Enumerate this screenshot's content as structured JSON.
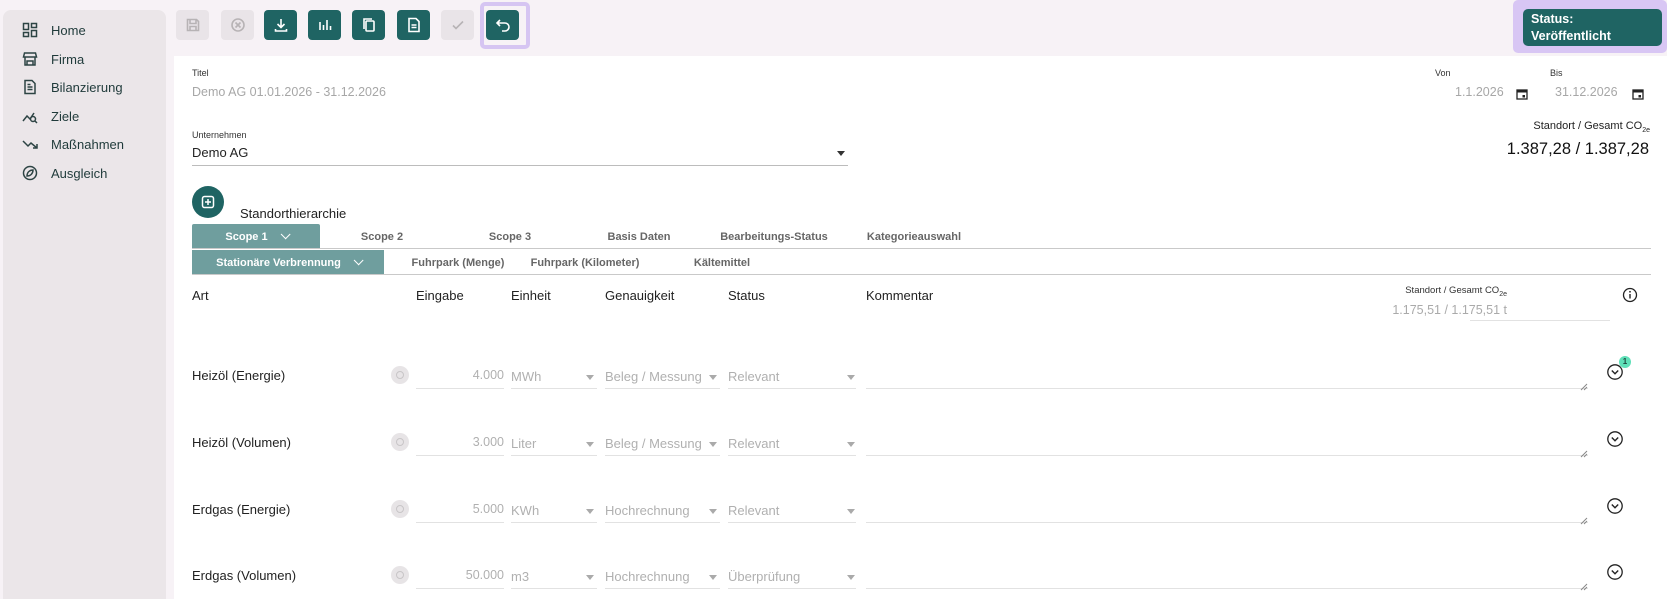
{
  "sidebar": {
    "items": [
      {
        "label": "Home",
        "icon": "dashboard-icon"
      },
      {
        "label": "Firma",
        "icon": "store-icon"
      },
      {
        "label": "Bilanzierung",
        "icon": "document-icon"
      },
      {
        "label": "Ziele",
        "icon": "target-chart-icon"
      },
      {
        "label": "Maßnahmen",
        "icon": "trend-down-icon"
      },
      {
        "label": "Ausgleich",
        "icon": "eco-icon"
      }
    ]
  },
  "toolbar": {
    "buttons": [
      {
        "name": "save-icon",
        "state": "disabled"
      },
      {
        "name": "cancel-icon",
        "state": "disabled"
      },
      {
        "name": "download-icon",
        "state": "active"
      },
      {
        "name": "chart-icon",
        "state": "active"
      },
      {
        "name": "copy-icon",
        "state": "active"
      },
      {
        "name": "file-icon",
        "state": "active"
      },
      {
        "name": "check-icon",
        "state": "disabled"
      },
      {
        "name": "undo-icon",
        "state": "active"
      }
    ]
  },
  "status": {
    "label_line1": "Status:",
    "label_line2": "Veröffentlicht"
  },
  "form": {
    "title_label": "Titel",
    "title_value": "Demo AG 01.01.2026 - 31.12.2026",
    "from_label": "Von",
    "from_value": "1.1.2026",
    "to_label": "Bis",
    "to_value": "31.12.2026",
    "company_label": "Unternehmen",
    "company_value": "Demo AG",
    "total_label": "Standort / Gesamt CO",
    "total_sub": "2e",
    "total_value": "1.387,28 / 1.387,28"
  },
  "hierarchy_title": "Standorthierarchie",
  "tabs": [
    "Scope 1",
    "Scope 2",
    "Scope 3",
    "Basis Daten",
    "Bearbeitungs-Status",
    "Kategorieauswahl"
  ],
  "subtabs": [
    "Stationäre Verbrennung",
    "Fuhrpark (Menge)",
    "Fuhrpark (Kilometer)",
    "Kältemittel"
  ],
  "columns": {
    "art": "Art",
    "eingabe": "Eingabe",
    "einheit": "Einheit",
    "genauigkeit": "Genauigkeit",
    "status": "Status",
    "kommentar": "Kommentar",
    "total_label": "Standort / Gesamt CO",
    "total_sub": "2e",
    "total_value": "1.175,51 / 1.175,51 t"
  },
  "rows": [
    {
      "art": "Heizöl (Energie)",
      "eingabe": "4.000",
      "einheit": "MWh",
      "genauigkeit": "Beleg / Messung",
      "status": "Relevant",
      "badge": "1"
    },
    {
      "art": "Heizöl (Volumen)",
      "eingabe": "3.000",
      "einheit": "Liter",
      "genauigkeit": "Beleg / Messung",
      "status": "Relevant"
    },
    {
      "art": "Erdgas (Energie)",
      "eingabe": "5.000",
      "einheit": "KWh",
      "genauigkeit": "Hochrechnung",
      "status": "Relevant"
    },
    {
      "art": "Erdgas (Volumen)",
      "eingabe": "50.000",
      "einheit": "m3",
      "genauigkeit": "Hochrechnung",
      "status": "Überprüfung"
    }
  ],
  "colors": {
    "primary": "#1f6463",
    "tab_selected": "#6f9e9e",
    "highlight": "#d6c5f2",
    "badge": "#5fe0b8"
  }
}
